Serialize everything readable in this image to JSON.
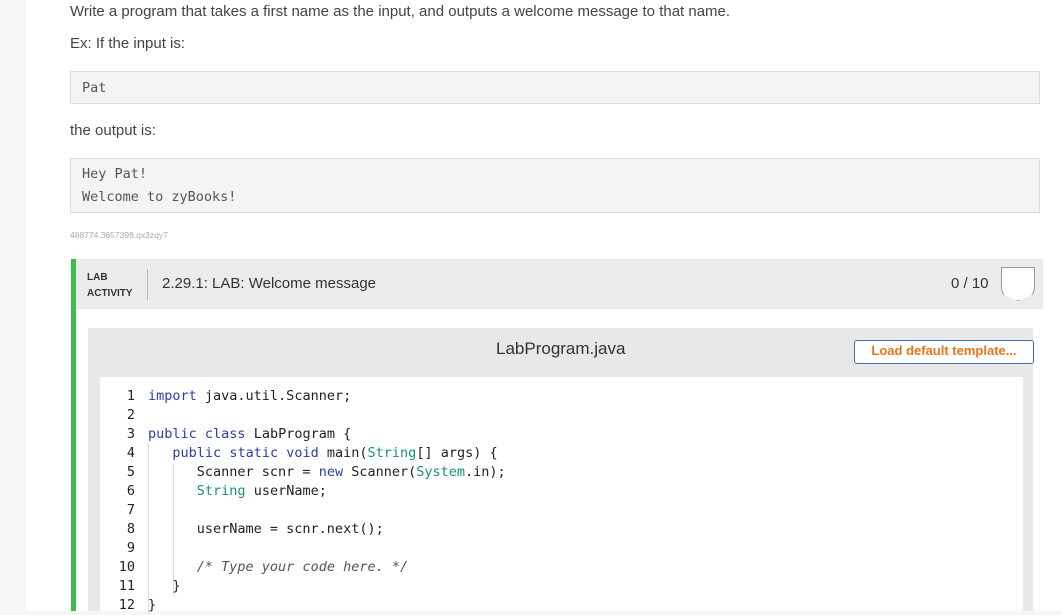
{
  "prompt": {
    "intro": "Write a program that takes a first name as the input, and outputs a welcome message to that name.",
    "example_label": "Ex: If the input is:",
    "input_example": "Pat",
    "output_label": "the output is:",
    "output_lines": [
      "Hey Pat!",
      "Welcome to zyBooks!"
    ],
    "meta_id": "488774.3657398.qx3zqy7"
  },
  "lab": {
    "tag_line1": "LAB",
    "tag_line2": "ACTIVITY",
    "title": "2.29.1: LAB: Welcome message",
    "score": "0 / 10"
  },
  "editor": {
    "filename": "LabProgram.java",
    "load_button": "Load default template...",
    "line_numbers": [
      "1",
      "2",
      "3",
      "4",
      "5",
      "6",
      "7",
      "8",
      "9",
      "10",
      "11",
      "12"
    ]
  },
  "colors": {
    "accent_green": "#3fbe4f",
    "button_text": "#e8741b",
    "button_border": "#3b6fbf",
    "keyword": "#2b3da8",
    "type": "#1a8f7a"
  }
}
